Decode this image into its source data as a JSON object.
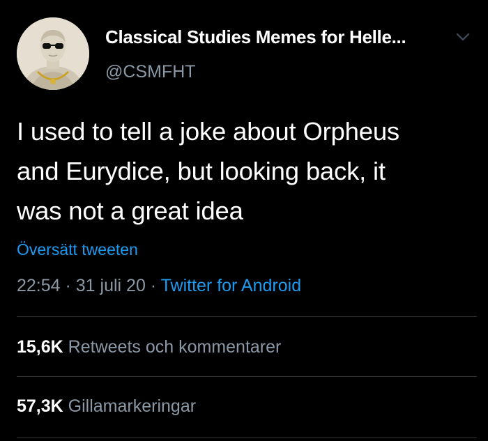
{
  "author": {
    "display_name": "Classical Studies Memes for Helle...",
    "handle": "@CSMFHT",
    "avatar_icon": "bust-with-sunglasses-avatar"
  },
  "menu_icon": "chevron-down-icon",
  "tweet": {
    "text_lines": [
      "I used to tell a joke about Orpheus",
      "and Eurydice, but looking back, it",
      "was not a great idea"
    ],
    "translate_label": "Översätt tweeten",
    "time": "22:54",
    "separator": " · ",
    "date": "31 juli 20",
    "source": "Twitter for Android"
  },
  "stats": {
    "retweets": {
      "count": "15,6K",
      "label": "Retweets och kommentarer"
    },
    "likes": {
      "count": "57,3K",
      "label": "Gillamarkeringar"
    }
  },
  "colors": {
    "background": "#000000",
    "text": "#ffffff",
    "secondary": "#8b98a5",
    "link": "#1d9bf0",
    "divider": "#2f3336"
  }
}
